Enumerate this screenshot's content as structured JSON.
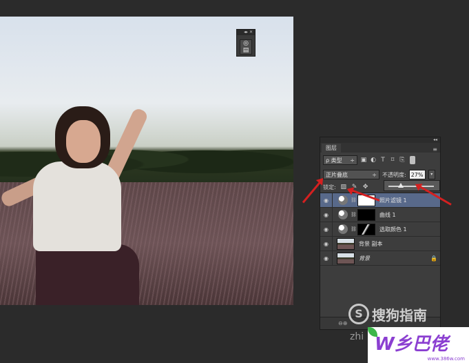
{
  "mini_panel": {
    "menu_glyph": "◂▸ ✕",
    "button_glyph": "◎\n▤"
  },
  "layers_panel": {
    "top_controls": "◂◂",
    "tab_label": "图层",
    "panel_menu": "≡",
    "filter": {
      "label": "ρ 类型",
      "arrow": "÷"
    },
    "filter_icons": [
      "▣",
      "◐",
      "T",
      "⌑",
      "⎘"
    ],
    "blend_mode": {
      "value": "正片叠底",
      "arrow": "÷"
    },
    "opacity": {
      "label": "不透明度:",
      "value": "27%",
      "arrow": "▾"
    },
    "opacity_slider_fraction": 0.27,
    "lock": {
      "label": "锁定:",
      "icons": [
        "▨",
        "✎",
        "✥",
        "🔒"
      ]
    },
    "layers": [
      {
        "name": "照片滤镜 1",
        "type": "adjustment",
        "mask": "white",
        "selected": true
      },
      {
        "name": "曲线 1",
        "type": "adjustment",
        "mask": "black",
        "selected": false
      },
      {
        "name": "选取颜色 1",
        "type": "adjustment",
        "mask": "sel",
        "selected": false
      },
      {
        "name": "背景 副本",
        "type": "image",
        "selected": false
      },
      {
        "name": "背景",
        "type": "image",
        "italic": true,
        "locked": true,
        "selected": false
      }
    ],
    "bottom_icons": "⊖⊕"
  },
  "watermarks": {
    "sogou_logo": "S",
    "sogou_text": "搜狗指南",
    "zhi_text": "zhi",
    "site_big": "W乡巴佬",
    "site_url": "www.386w.com"
  },
  "colors": {
    "selected_row": "#58698a",
    "arrow": "#d42020",
    "panel_bg": "#3d3d3d"
  }
}
